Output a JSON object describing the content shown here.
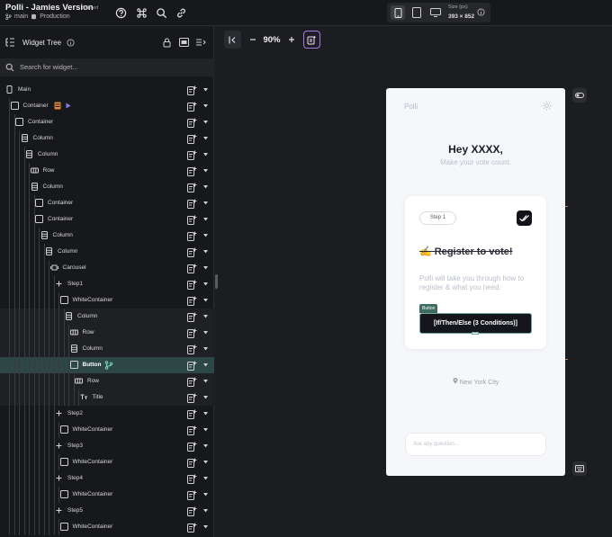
{
  "topbar": {
    "project_title": "Polli - Jamies Version",
    "sync_status": "Synced",
    "branch": "main",
    "environment": "Production",
    "icons": [
      "help-icon",
      "command-icon",
      "search-icon",
      "link-icon"
    ],
    "devices": [
      "phone-icon",
      "tablet-icon",
      "desktop-icon"
    ],
    "active_device": "phone",
    "size_label": "Size (px)",
    "size_value": "393 × 852"
  },
  "panel": {
    "title": "Widget Tree",
    "search_placeholder": "Search for widget..."
  },
  "tree": [
    {
      "label": "Main",
      "icon": "phone-icon",
      "depth": 0
    },
    {
      "label": "Container",
      "icon": "container-icon",
      "depth": 1,
      "extra": "db-play"
    },
    {
      "label": "Container",
      "icon": "container-icon",
      "depth": 2
    },
    {
      "label": "Column",
      "icon": "column-icon",
      "depth": 3
    },
    {
      "label": "Column",
      "icon": "column-icon",
      "depth": 4
    },
    {
      "label": "Row",
      "icon": "row-icon",
      "depth": 5
    },
    {
      "label": "Column",
      "icon": "column-icon",
      "depth": 5
    },
    {
      "label": "Container",
      "icon": "container-icon",
      "depth": 6
    },
    {
      "label": "Container",
      "icon": "container-icon",
      "depth": 6
    },
    {
      "label": "Column",
      "icon": "column-icon",
      "depth": 7
    },
    {
      "label": "Column",
      "icon": "column-icon",
      "depth": 8
    },
    {
      "label": "Carousel",
      "icon": "carousel-icon",
      "depth": 9
    },
    {
      "label": "Step1",
      "icon": "plus-icon",
      "depth": 10
    },
    {
      "label": "WhiteContainer",
      "icon": "container-icon",
      "depth": 11
    },
    {
      "label": "Column",
      "icon": "column-icon",
      "depth": 12
    },
    {
      "label": "Row",
      "icon": "row-icon",
      "depth": 13
    },
    {
      "label": "Column",
      "icon": "column-icon",
      "depth": 13
    },
    {
      "label": "Button",
      "icon": "container-icon",
      "depth": 13,
      "selected": true,
      "extra": "branch"
    },
    {
      "label": "Row",
      "icon": "row-icon",
      "depth": 14
    },
    {
      "label": "Title",
      "icon": "text-icon",
      "depth": 15
    },
    {
      "label": "Step2",
      "icon": "plus-icon",
      "depth": 10
    },
    {
      "label": "WhiteContainer",
      "icon": "container-icon",
      "depth": 11
    },
    {
      "label": "Step3",
      "icon": "plus-icon",
      "depth": 10
    },
    {
      "label": "WhiteContainer",
      "icon": "container-icon",
      "depth": 11
    },
    {
      "label": "Step4",
      "icon": "plus-icon",
      "depth": 10
    },
    {
      "label": "WhiteContainer",
      "icon": "container-icon",
      "depth": 11
    },
    {
      "label": "Step5",
      "icon": "plus-icon",
      "depth": 10
    },
    {
      "label": "WhiteContainer",
      "icon": "container-icon",
      "depth": 11
    }
  ],
  "canvas": {
    "zoom": "90%"
  },
  "preview": {
    "app_name": "Polli",
    "greeting": "Hey XXXX,",
    "tagline": "Make your vote count.",
    "step_pill": "Step 1",
    "register_title": "✍️ Register to vote!",
    "register_body": "Polli will take you through how to register & what you need.",
    "button_tag": "Button",
    "button_label": "[If/Then/Else (3 Conditions)]",
    "location": "New York City",
    "chat_placeholder": "Ask any question..."
  },
  "colors": {
    "selected_row": "#2c4745",
    "accent_teal": "#6ea397",
    "frame_orange": "#c47a3a",
    "ai_button": "#a07be0"
  }
}
